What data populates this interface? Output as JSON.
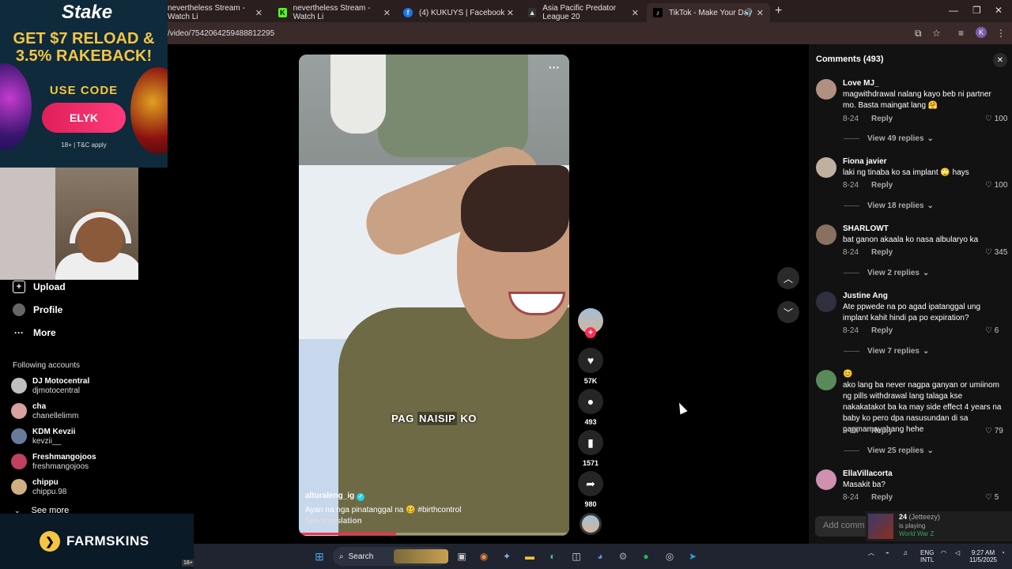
{
  "browser": {
    "tabs": [
      {
        "title": "nevertheless Stream - Watch Li",
        "icon_color": "#3a2a2a"
      },
      {
        "title": "nevertheless Stream - Watch Li",
        "icon_color": "#53fc18"
      },
      {
        "title": "(4) KUKUYS | Facebook",
        "icon_color": "#1877f2"
      },
      {
        "title": "Asia Pacific Predator League 20",
        "icon_color": "#444"
      },
      {
        "title": "TikTok - Make Your Day",
        "icon_color": "#000"
      }
    ],
    "url": "/video/7542064259488812295",
    "profile_initial": "K"
  },
  "ad": {
    "brand": "Stake",
    "headline": "GET $7 RELOAD & 3.5% RAKEBACK!",
    "code_label": "USE CODE",
    "code": "ELYK",
    "fine_print": "18+ | T&C apply"
  },
  "sidebar": {
    "items": [
      {
        "label": "Upload",
        "icon": "plus-square-icon"
      },
      {
        "label": "Profile",
        "icon": "avatar-icon"
      },
      {
        "label": "More",
        "icon": "more-dots-icon"
      }
    ],
    "section_title": "Following accounts",
    "accounts": [
      {
        "name": "DJ Motocentral",
        "handle": "djmotocentral",
        "color": "#c0c0c0"
      },
      {
        "name": "cha",
        "handle": "chanellelimm",
        "color": "#d9a0a0"
      },
      {
        "name": "KDM Kevzii",
        "handle": "kevzii__",
        "color": "#6a7a9a"
      },
      {
        "name": "Freshmangojoos",
        "handle": "freshmangojoos",
        "color": "#c04060"
      },
      {
        "name": "chippu",
        "handle": "chippu.98",
        "color": "#d0b080"
      }
    ],
    "see_more": "See more"
  },
  "farmskins": {
    "name": "FARMSKINS",
    "badge": "18+"
  },
  "video": {
    "caption_overlay": [
      "PAG",
      "NAISIP",
      "KO"
    ],
    "username": "alturaleng_ig",
    "description": "Ayan na nga pinatanggal na 🥴 #birthcontrol",
    "see_translation": "See translation",
    "progress": 0.36
  },
  "actions": {
    "likes": "57K",
    "comments": "493",
    "saves": "1571",
    "shares": "980"
  },
  "comments": {
    "header": "Comments (493)",
    "items": [
      {
        "name": "Love MJ_",
        "text": "magwithdrawal nalang kayo beb ni partner mo. Basta maingat lang 🤗",
        "date": "8-24",
        "reply": "Reply",
        "likes": "100",
        "replies": "View 49 replies",
        "avatar": "#b09080"
      },
      {
        "name": "Fiona javier",
        "text": "laki ng tinaba ko sa implant 🙄 hays",
        "date": "8-24",
        "reply": "Reply",
        "likes": "100",
        "replies": "View 18 replies",
        "avatar": "#c0b0a0"
      },
      {
        "name": "SHARLOWT",
        "text": "bat ganon akaala ko nasa albularyo ka",
        "date": "8-24",
        "reply": "Reply",
        "likes": "345",
        "replies": "View 2 replies",
        "avatar": "#8a7060"
      },
      {
        "name": "Justine Ang",
        "text": "Ate ppwede na po agad ipatanggal ung implant kahit hindi pa po expiration?",
        "date": "8-24",
        "reply": "Reply",
        "likes": "6",
        "replies": "View 7 replies",
        "avatar": "#303040"
      },
      {
        "name": "😊",
        "text": "ako lang ba never nagpa ganyan or umiinom ng pills withdrawal lang talaga kse nakakatakot ba ka may side effect 4 years na baby ko pero dpa nasusundan di sa pagmamayabang hehe",
        "date": "8-24",
        "reply": "Reply",
        "likes": "79",
        "replies": "View 25 replies",
        "avatar": "#5a8a5a"
      },
      {
        "name": "EllaVillacorta",
        "text": "Masakit ba?",
        "date": "8-24",
        "reply": "Reply",
        "likes": "5",
        "replies": "",
        "avatar": "#d090b0"
      }
    ],
    "add_placeholder": "Add comm"
  },
  "now_playing": {
    "title": "24",
    "artist": "(Jetteezy)",
    "status": "is playing",
    "game": "World War Z"
  },
  "taskbar": {
    "search_label": "Search",
    "lang1": "ENG",
    "lang2": "INTL",
    "time": "9:27 AM",
    "date": "11/5/2025"
  }
}
